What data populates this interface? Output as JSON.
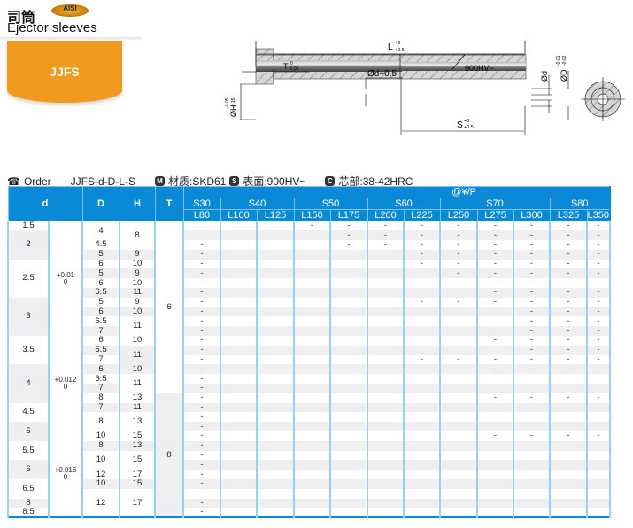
{
  "header": {
    "title_cn": "司筒",
    "aisi_badge": "AISI",
    "title_en": "Ejector sleeves",
    "series_code": "JJFS"
  },
  "drawing": {
    "L_label": "L",
    "L_tol_upper": "+3",
    "L_tol_lower": "+0.5",
    "T_label": "T",
    "T_tol_upper": "0",
    "T_tol_lower": "-0.03",
    "d_label": "Ød+0.5",
    "hardness_label": "900HV~",
    "H_label": "ØH",
    "H_tol_upper": "-0.05",
    "H_tol_lower": "-0.15",
    "S_label": "S",
    "S_tol_upper": "+3",
    "S_tol_lower": "+0.5",
    "d_dim_label": "Ød",
    "D_label": "ØD",
    "D_tol_upper": "-0.01",
    "D_tol_lower": "-0.02"
  },
  "order": {
    "order_label": "Order",
    "order_code": "JJFS-d-D-L-S",
    "material_icon": "M",
    "material": "材质:SKD61",
    "surface_icon": "S",
    "surface": "表面:900HV~",
    "core_icon": "C",
    "core": "芯部:38-42HRC"
  },
  "table": {
    "headers": {
      "d": "d",
      "D": "D",
      "H": "H",
      "T": "T",
      "price_unit": "@¥/P"
    },
    "s_groups": [
      {
        "label": "S30",
        "span": 1
      },
      {
        "label": "S40",
        "span": 2
      },
      {
        "label": "S50",
        "span": 2
      },
      {
        "label": "S60",
        "span": 2
      },
      {
        "label": "S70",
        "span": 3
      },
      {
        "label": "S80",
        "span": 2
      }
    ],
    "l_columns": [
      "L80",
      "L100",
      "L125",
      "L150",
      "L175",
      "L200",
      "L225",
      "L250",
      "L275",
      "L300",
      "L325",
      "L350"
    ],
    "d_values": [
      {
        "value": "1.5",
        "rows": 1
      },
      {
        "value": "2",
        "rows": 3
      },
      {
        "value": "2.5",
        "rows": 4
      },
      {
        "value": "3",
        "rows": 4
      },
      {
        "value": "3.5",
        "rows": 3
      },
      {
        "value": "4",
        "rows": 4
      },
      {
        "value": "4.5",
        "rows": 2
      },
      {
        "value": "5",
        "rows": 2
      },
      {
        "value": "5.5",
        "rows": 2
      },
      {
        "value": "6",
        "rows": 2
      },
      {
        "value": "6.5",
        "rows": 2
      },
      {
        "value": "8",
        "rows": 1
      },
      {
        "value": "8.5",
        "rows": 1
      }
    ],
    "d_tolerances": [
      {
        "upper": "+0.01",
        "lower": "0",
        "rows": 12
      },
      {
        "upper": "+0.012",
        "lower": "0",
        "rows": 10
      },
      {
        "upper": "+0.016",
        "lower": "0",
        "rows": 9
      }
    ],
    "D_values": [
      {
        "value": "4",
        "rows": 2
      },
      {
        "value": "4.5",
        "rows": 1
      },
      {
        "value": "5",
        "rows": 1
      },
      {
        "value": "6",
        "rows": 1
      },
      {
        "value": "5",
        "rows": 1
      },
      {
        "value": "6",
        "rows": 1
      },
      {
        "value": "6.5",
        "rows": 1
      },
      {
        "value": "5",
        "rows": 1
      },
      {
        "value": "6",
        "rows": 1
      },
      {
        "value": "6.5",
        "rows": 1
      },
      {
        "value": "7",
        "rows": 1
      },
      {
        "value": "6",
        "rows": 1
      },
      {
        "value": "6.5",
        "rows": 1
      },
      {
        "value": "7",
        "rows": 1
      },
      {
        "value": "6",
        "rows": 1
      },
      {
        "value": "6.5",
        "rows": 1
      },
      {
        "value": "7",
        "rows": 1
      },
      {
        "value": "8",
        "rows": 1
      },
      {
        "value": "7",
        "rows": 1
      },
      {
        "value": "8",
        "rows": 2
      },
      {
        "value": "10",
        "rows": 1
      },
      {
        "value": "8",
        "rows": 1
      },
      {
        "value": "10",
        "rows": 2
      },
      {
        "value": "12",
        "rows": 1
      },
      {
        "value": "10",
        "rows": 1
      },
      {
        "value": "12",
        "rows": 3
      }
    ],
    "H_values": [
      {
        "value": "8",
        "rows": 3
      },
      {
        "value": "9",
        "rows": 1
      },
      {
        "value": "10",
        "rows": 1
      },
      {
        "value": "9",
        "rows": 1
      },
      {
        "value": "10",
        "rows": 1
      },
      {
        "value": "11",
        "rows": 1
      },
      {
        "value": "9",
        "rows": 1
      },
      {
        "value": "10",
        "rows": 1
      },
      {
        "value": "11",
        "rows": 2
      },
      {
        "value": "10",
        "rows": 1
      },
      {
        "value": "11",
        "rows": 2
      },
      {
        "value": "10",
        "rows": 1
      },
      {
        "value": "11",
        "rows": 2
      },
      {
        "value": "13",
        "rows": 1
      },
      {
        "value": "11",
        "rows": 1
      },
      {
        "value": "13",
        "rows": 2
      },
      {
        "value": "15",
        "rows": 1
      },
      {
        "value": "13",
        "rows": 1
      },
      {
        "value": "15",
        "rows": 2
      },
      {
        "value": "17",
        "rows": 1
      },
      {
        "value": "15",
        "rows": 1
      },
      {
        "value": "17",
        "rows": 3
      }
    ],
    "T_values": [
      {
        "value": "6",
        "rows": 18
      },
      {
        "value": "8",
        "rows": 13
      }
    ],
    "availability_mark": "-",
    "availability": [
      [
        0,
        0,
        0,
        1,
        1,
        1,
        1,
        1,
        1,
        1,
        1,
        1
      ],
      [
        0,
        0,
        0,
        0,
        1,
        1,
        1,
        1,
        1,
        1,
        1,
        1
      ],
      [
        1,
        0,
        0,
        0,
        1,
        1,
        1,
        1,
        1,
        1,
        1,
        1
      ],
      [
        1,
        0,
        0,
        0,
        0,
        0,
        1,
        1,
        1,
        1,
        1,
        1
      ],
      [
        1,
        0,
        0,
        0,
        0,
        0,
        1,
        1,
        1,
        1,
        1,
        1
      ],
      [
        1,
        0,
        0,
        0,
        0,
        0,
        0,
        1,
        1,
        1,
        1,
        1
      ],
      [
        1,
        0,
        0,
        0,
        0,
        0,
        0,
        0,
        1,
        1,
        1,
        1
      ],
      [
        1,
        0,
        0,
        0,
        0,
        0,
        0,
        0,
        1,
        1,
        1,
        1
      ],
      [
        1,
        0,
        0,
        0,
        0,
        0,
        1,
        1,
        1,
        1,
        1,
        1
      ],
      [
        1,
        0,
        0,
        0,
        0,
        0,
        0,
        0,
        0,
        1,
        1,
        1
      ],
      [
        1,
        0,
        0,
        0,
        0,
        0,
        0,
        0,
        0,
        1,
        1,
        1
      ],
      [
        1,
        0,
        0,
        0,
        0,
        0,
        0,
        0,
        0,
        1,
        1,
        1
      ],
      [
        1,
        0,
        0,
        0,
        0,
        0,
        0,
        0,
        1,
        1,
        1,
        1
      ],
      [
        1,
        0,
        0,
        0,
        0,
        0,
        0,
        0,
        0,
        1,
        1,
        1
      ],
      [
        1,
        0,
        0,
        0,
        0,
        0,
        1,
        1,
        1,
        1,
        1,
        1
      ],
      [
        1,
        0,
        0,
        0,
        0,
        0,
        0,
        0,
        1,
        1,
        1,
        1
      ],
      [
        1,
        0,
        0,
        0,
        0,
        0,
        0,
        0,
        0,
        0,
        0,
        0
      ],
      [
        1,
        0,
        0,
        0,
        0,
        0,
        0,
        0,
        0,
        0,
        0,
        0
      ],
      [
        1,
        0,
        0,
        0,
        0,
        0,
        0,
        0,
        1,
        1,
        1,
        1
      ],
      [
        1,
        0,
        0,
        0,
        0,
        0,
        0,
        0,
        0,
        0,
        0,
        0
      ],
      [
        1,
        0,
        0,
        0,
        0,
        0,
        0,
        0,
        0,
        0,
        0,
        0
      ],
      [
        1,
        0,
        0,
        0,
        0,
        0,
        0,
        0,
        0,
        0,
        0,
        0
      ],
      [
        1,
        0,
        0,
        0,
        0,
        0,
        0,
        0,
        1,
        1,
        1,
        1
      ],
      [
        1,
        0,
        0,
        0,
        0,
        0,
        0,
        0,
        0,
        0,
        0,
        0
      ],
      [
        1,
        0,
        0,
        0,
        0,
        0,
        0,
        0,
        0,
        0,
        0,
        0
      ],
      [
        1,
        0,
        0,
        0,
        0,
        0,
        0,
        0,
        0,
        0,
        0,
        0
      ],
      [
        1,
        0,
        0,
        0,
        0,
        0,
        0,
        0,
        0,
        0,
        0,
        0
      ],
      [
        1,
        0,
        0,
        0,
        0,
        0,
        0,
        0,
        0,
        0,
        0,
        0
      ],
      [
        1,
        0,
        0,
        0,
        0,
        0,
        0,
        0,
        0,
        0,
        0,
        0
      ],
      [
        1,
        0,
        0,
        0,
        0,
        0,
        0,
        0,
        0,
        0,
        0,
        0
      ],
      [
        1,
        0,
        0,
        0,
        0,
        0,
        0,
        0,
        0,
        0,
        0,
        0
      ]
    ]
  }
}
